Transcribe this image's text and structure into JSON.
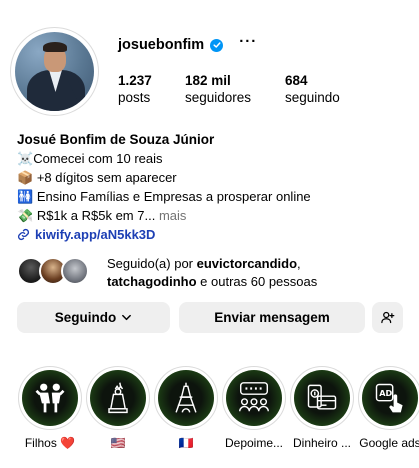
{
  "profile": {
    "username": "josuebonfim",
    "stats": [
      {
        "value": "1.237",
        "label": "posts"
      },
      {
        "value": "182 mil",
        "label": "seguidores"
      },
      {
        "value": "684",
        "label": "seguindo"
      }
    ],
    "name": "Josué Bonfim de Souza Júnior",
    "bio_lines": [
      {
        "emoji": "☠️",
        "text": "Comecei com 10 reais"
      },
      {
        "emoji": "📦",
        "text": "+8 dígitos sem aparecer"
      },
      {
        "emoji": "🚻",
        "text": "Ensino Famílias e Empresas a prosperar online"
      },
      {
        "emoji": "💸",
        "text": "R$1k a R$5k em 7..."
      }
    ],
    "bio_more": "mais",
    "link": "kiwify.app/aN5kk3D"
  },
  "followed_by": {
    "prefix": "Seguido(a) por ",
    "user1": "euvictorcandido",
    "sep": ",",
    "user2": "tatchagodinho",
    "suffix": " e outras 60 pessoas"
  },
  "actions": {
    "following_label": "Seguindo",
    "message_label": "Enviar mensagem"
  },
  "highlights": [
    {
      "label": "Filhos ❤️",
      "icon": "family-icon"
    },
    {
      "label": "🇺🇸",
      "icon": "statue-of-liberty-icon"
    },
    {
      "label": "🇫🇷",
      "icon": "eiffel-tower-icon"
    },
    {
      "label": "Depoime...",
      "icon": "testimonials-icon"
    },
    {
      "label": "Dinheiro ...",
      "icon": "money-icon"
    },
    {
      "label": "Google ads",
      "icon": "ads-icon"
    }
  ],
  "colors": {
    "verified": "#0095f6",
    "link": "#1d3fb4",
    "button_bg": "#efefef",
    "highlight_green": "#6ed62a"
  }
}
